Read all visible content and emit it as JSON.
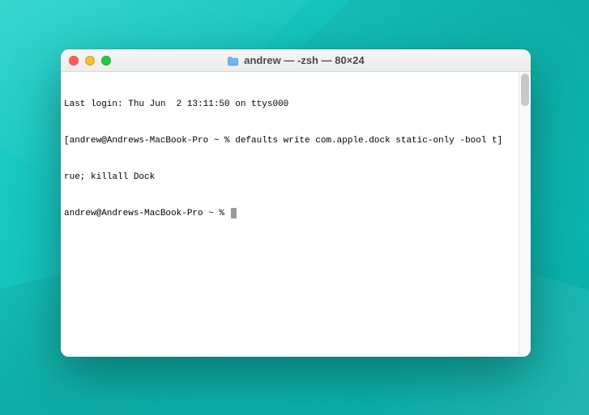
{
  "window": {
    "title": "andrew — -zsh — 80×24"
  },
  "terminal": {
    "line1": "Last login: Thu Jun  2 13:11:50 on ttys000",
    "line2": "[andrew@Andrews-MacBook-Pro ~ % defaults write com.apple.dock static-only -bool t]",
    "line3": "rue; killall Dock",
    "prompt": "andrew@Andrews-MacBook-Pro ~ % "
  }
}
